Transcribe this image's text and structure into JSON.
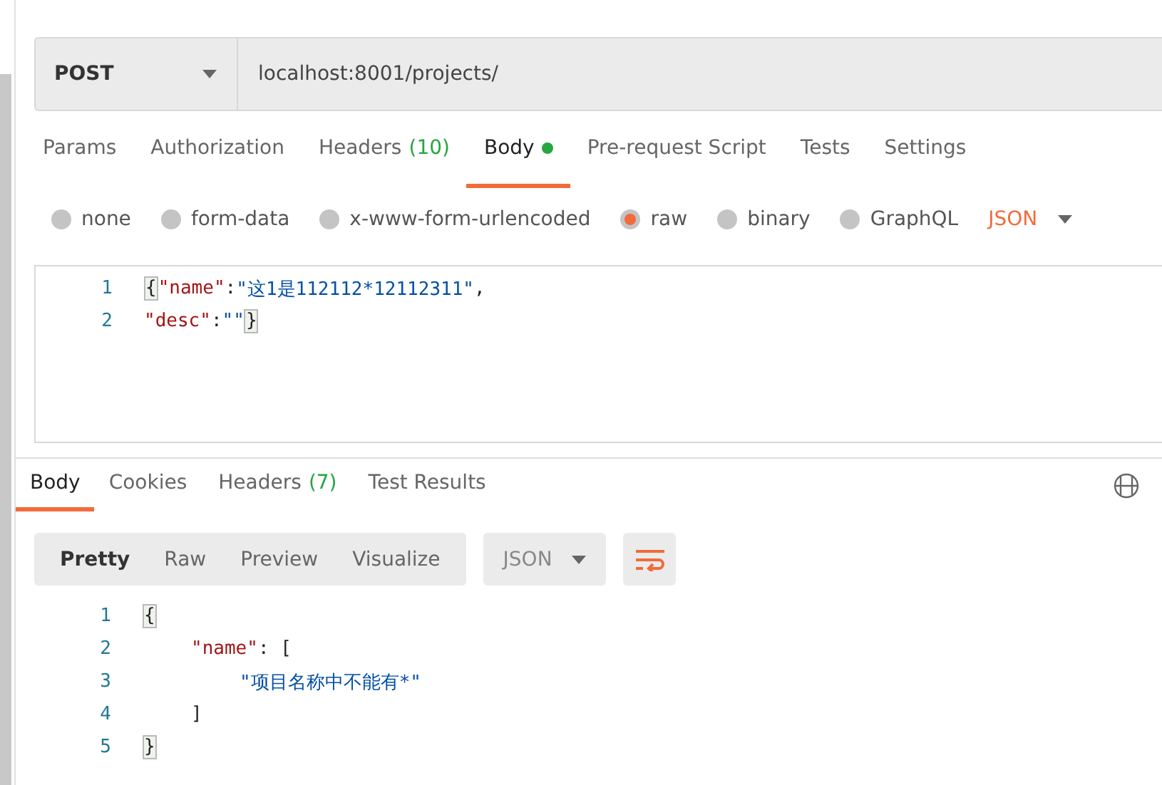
{
  "request": {
    "method": "POST",
    "url": "localhost:8001/projects/"
  },
  "request_tabs": [
    {
      "label": "Params",
      "selected": false,
      "indicator": false
    },
    {
      "label": "Authorization",
      "selected": false,
      "indicator": false
    },
    {
      "label": "Headers",
      "count": "(10)",
      "selected": false,
      "indicator": false
    },
    {
      "label": "Body",
      "selected": true,
      "indicator": true
    },
    {
      "label": "Pre-request Script",
      "selected": false,
      "indicator": false
    },
    {
      "label": "Tests",
      "selected": false,
      "indicator": false
    },
    {
      "label": "Settings",
      "selected": false,
      "indicator": false
    }
  ],
  "body_types": [
    {
      "label": "none",
      "selected": false
    },
    {
      "label": "form-data",
      "selected": false
    },
    {
      "label": "x-www-form-urlencoded",
      "selected": false
    },
    {
      "label": "raw",
      "selected": true
    },
    {
      "label": "binary",
      "selected": false
    },
    {
      "label": "GraphQL",
      "selected": false
    }
  ],
  "body_format": "JSON",
  "request_body": [
    {
      "number": "1",
      "tokens": [
        {
          "kind": "bracket",
          "text": "{"
        },
        {
          "kind": "key",
          "text": "\"name\""
        },
        {
          "kind": "punct",
          "text": ":"
        },
        {
          "kind": "string",
          "text": "\"这1是112112*12112311\""
        },
        {
          "kind": "punct",
          "text": ","
        }
      ]
    },
    {
      "number": "2",
      "tokens": [
        {
          "kind": "key",
          "text": "\"desc\""
        },
        {
          "kind": "punct",
          "text": ":"
        },
        {
          "kind": "string",
          "text": "\"\""
        },
        {
          "kind": "bracket",
          "text": "}"
        }
      ]
    }
  ],
  "response_tabs": [
    {
      "label": "Body",
      "selected": true
    },
    {
      "label": "Cookies",
      "selected": false
    },
    {
      "label": "Headers",
      "count": "(7)",
      "selected": false
    },
    {
      "label": "Test Results",
      "selected": false
    }
  ],
  "view_modes": [
    {
      "label": "Pretty",
      "selected": true
    },
    {
      "label": "Raw",
      "selected": false
    },
    {
      "label": "Preview",
      "selected": false
    },
    {
      "label": "Visualize",
      "selected": false
    }
  ],
  "response_format": "JSON",
  "response_body": [
    {
      "number": "1",
      "tokens": [
        {
          "kind": "bracket",
          "text": "{"
        }
      ],
      "children": [
        {
          "number": "2",
          "tokens": [
            {
              "kind": "key",
              "text": "\"name\""
            },
            {
              "kind": "punct",
              "text": ": ["
            }
          ],
          "children": [
            {
              "number": "3",
              "tokens": [
                {
                  "kind": "string",
                  "text": "\"项目名称中不能有*\""
                }
              ]
            }
          ]
        },
        {
          "number": "4",
          "tokens": [
            {
              "kind": "punct",
              "text": "]"
            }
          ]
        }
      ]
    },
    {
      "number": "5",
      "tokens": [
        {
          "kind": "bracket",
          "text": "}"
        }
      ]
    }
  ]
}
